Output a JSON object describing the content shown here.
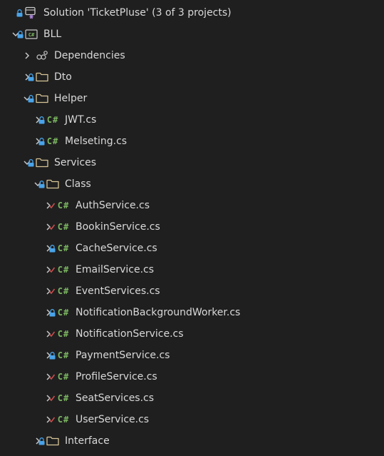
{
  "colors": {
    "background": "#1f1f1f",
    "text": "#d9d9d9",
    "chevron": "#c8c8c8",
    "lock": "#4aa3e8",
    "check": "#c74e4e",
    "csharp": "#7bb661",
    "folder": "#d7c596"
  },
  "solution": {
    "label": "Solution 'TicketPluse' (3 of 3 projects)",
    "icon": "solution-icon",
    "mark": "lock"
  },
  "tree": [
    {
      "label": "BLL",
      "level": 0,
      "expander": "expanded",
      "mark": "lock",
      "icon": "csharp-project-icon"
    },
    {
      "label": "Dependencies",
      "level": 1,
      "expander": "collapsed",
      "mark": "none",
      "icon": "dependencies-icon"
    },
    {
      "label": "Dto",
      "level": 1,
      "expander": "collapsed",
      "mark": "lock",
      "icon": "folder-icon"
    },
    {
      "label": "Helper",
      "level": 1,
      "expander": "expanded",
      "mark": "lock",
      "icon": "folder-icon"
    },
    {
      "label": "JWT.cs",
      "level": 2,
      "expander": "collapsed",
      "mark": "lock",
      "icon": "csharp-file-icon",
      "icon_text": "C#"
    },
    {
      "label": "Melseting.cs",
      "level": 2,
      "expander": "collapsed",
      "mark": "lock",
      "icon": "csharp-file-icon",
      "icon_text": "C#"
    },
    {
      "label": "Services",
      "level": 1,
      "expander": "expanded",
      "mark": "lock",
      "icon": "folder-icon"
    },
    {
      "label": "Class",
      "level": 2,
      "expander": "expanded",
      "mark": "lock",
      "icon": "folder-icon"
    },
    {
      "label": "AuthService.cs",
      "level": 3,
      "expander": "collapsed",
      "mark": "check",
      "icon": "csharp-file-icon",
      "icon_text": "C#"
    },
    {
      "label": "BookinService.cs",
      "level": 3,
      "expander": "collapsed",
      "mark": "check",
      "icon": "csharp-file-icon",
      "icon_text": "C#"
    },
    {
      "label": "CacheService.cs",
      "level": 3,
      "expander": "collapsed",
      "mark": "lock",
      "icon": "csharp-file-icon",
      "icon_text": "C#"
    },
    {
      "label": "EmailService.cs",
      "level": 3,
      "expander": "collapsed",
      "mark": "check",
      "icon": "csharp-file-icon",
      "icon_text": "C#"
    },
    {
      "label": "EventServices.cs",
      "level": 3,
      "expander": "collapsed",
      "mark": "check",
      "icon": "csharp-file-icon",
      "icon_text": "C#"
    },
    {
      "label": "NotificationBackgroundWorker.cs",
      "level": 3,
      "expander": "collapsed",
      "mark": "lock",
      "icon": "csharp-file-icon",
      "icon_text": "C#"
    },
    {
      "label": "NotificationService.cs",
      "level": 3,
      "expander": "collapsed",
      "mark": "check",
      "icon": "csharp-file-icon",
      "icon_text": "C#"
    },
    {
      "label": "PaymentService.cs",
      "level": 3,
      "expander": "collapsed",
      "mark": "lock",
      "icon": "csharp-file-icon",
      "icon_text": "C#"
    },
    {
      "label": "ProfileService.cs",
      "level": 3,
      "expander": "collapsed",
      "mark": "check",
      "icon": "csharp-file-icon",
      "icon_text": "C#"
    },
    {
      "label": "SeatServices.cs",
      "level": 3,
      "expander": "collapsed",
      "mark": "check",
      "icon": "csharp-file-icon",
      "icon_text": "C#"
    },
    {
      "label": "UserService.cs",
      "level": 3,
      "expander": "collapsed",
      "mark": "check",
      "icon": "csharp-file-icon",
      "icon_text": "C#"
    },
    {
      "label": "Interface",
      "level": 2,
      "expander": "collapsed",
      "mark": "lock",
      "icon": "folder-icon"
    }
  ]
}
